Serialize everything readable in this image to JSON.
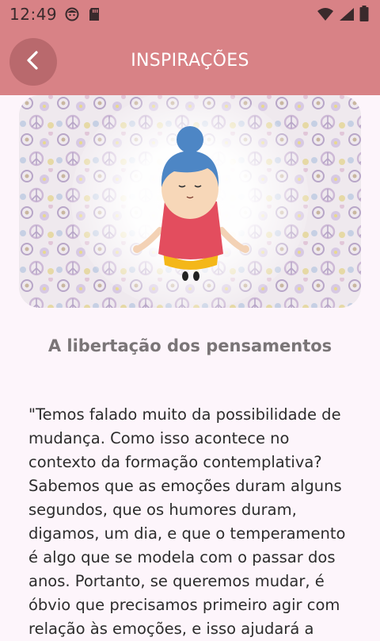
{
  "status_bar": {
    "time": "12:49",
    "icons": [
      "face-icon",
      "sd-card-icon",
      "wifi-icon",
      "signal-icon",
      "battery-icon"
    ]
  },
  "app_bar": {
    "title": "INSPIRAÇÕES",
    "back_icon": "chevron-left-icon"
  },
  "hero": {
    "illustration": "meditating-woman-with-flower-pattern"
  },
  "article": {
    "title": "A libertação dos pensamentos",
    "body": "\"Temos falado muito da possibilidade de mudança. Como isso acontece no contexto da formação contemplativa? Sabemos que as emoções duram alguns segundos, que os humores duram, digamos, um dia, e que o temperamento é algo que se modela com o passar dos anos. Portanto, se queremos mudar, é óbvio que precisamos primeiro agir com relação às emoções, e isso ajudará a"
  },
  "colors": {
    "app_bar": "#d88286",
    "back_button": "#b9696d",
    "background": "#fdf5fb",
    "title_text": "#7a7577"
  }
}
